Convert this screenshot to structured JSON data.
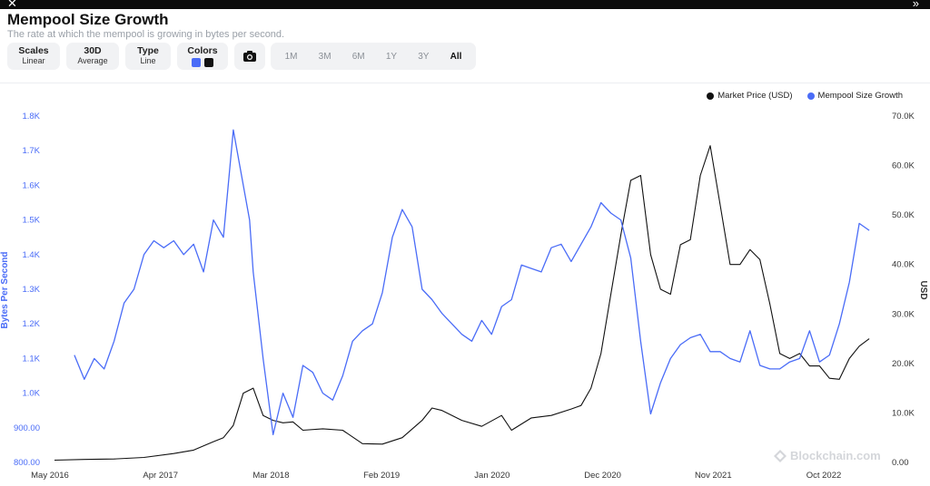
{
  "window": {
    "close_glyph": "✕",
    "collapse_glyph": "»"
  },
  "header": {
    "title": "Mempool Size Growth",
    "subtitle": "The rate at which the mempool is growing in bytes per second."
  },
  "controls": {
    "scales": {
      "label": "Scales",
      "value": "Linear"
    },
    "average": {
      "label": "30D",
      "value": "Average"
    },
    "type": {
      "label": "Type",
      "value": "Line"
    },
    "colors": {
      "label": "Colors",
      "swatch1": "#4a6cf7",
      "swatch2": "#111111"
    },
    "camera_icon": "camera-icon",
    "ranges": [
      "1M",
      "3M",
      "6M",
      "1Y",
      "3Y",
      "All"
    ],
    "active_range": "All"
  },
  "legend": {
    "items": [
      {
        "label": "Market Price (USD)",
        "color": "#111111"
      },
      {
        "label": "Mempool Size Growth",
        "color": "#4a6cf7"
      }
    ]
  },
  "watermark": {
    "text": "Blockchain.com"
  },
  "chart_data": {
    "type": "line",
    "title": "Mempool Size Growth",
    "xlabel": "",
    "ylabel_left": "Bytes Per Second",
    "ylabel_right": "USD",
    "x_tick_labels": [
      "May 2016",
      "Apr 2017",
      "Mar 2018",
      "Feb 2019",
      "Jan 2020",
      "Dec 2020",
      "Nov 2021",
      "Oct 2022"
    ],
    "y_left_ticks": [
      "800.00",
      "900.00",
      "1.0K",
      "1.1K",
      "1.2K",
      "1.3K",
      "1.4K",
      "1.5K",
      "1.6K",
      "1.7K",
      "1.8K"
    ],
    "y_right_ticks": [
      "0.00",
      "10.0K",
      "20.0K",
      "30.0K",
      "40.0K",
      "50.0K",
      "60.0K",
      "70.0K"
    ],
    "ylim_left": [
      800,
      1800
    ],
    "ylim_right": [
      0,
      70000
    ],
    "x_range": [
      "2016-05",
      "2023-04"
    ],
    "legend_position": "top-right",
    "series": [
      {
        "name": "Mempool Size Growth",
        "axis": "left",
        "color": "#4a6cf7",
        "x": [
          "2016-07",
          "2016-08",
          "2016-09",
          "2016-10",
          "2016-11",
          "2016-12",
          "2017-01",
          "2017-02",
          "2017-03",
          "2017-04",
          "2017-05",
          "2017-06",
          "2017-07",
          "2017-08",
          "2017-09",
          "2017-10",
          "2017-11",
          "2017-12",
          "2017-12-20",
          "2018-01",
          "2018-02",
          "2018-03",
          "2018-04",
          "2018-05",
          "2018-06",
          "2018-07",
          "2018-08",
          "2018-09",
          "2018-10",
          "2018-11",
          "2018-12",
          "2019-01",
          "2019-02",
          "2019-03",
          "2019-04",
          "2019-05",
          "2019-06",
          "2019-07",
          "2019-08",
          "2019-09",
          "2019-10",
          "2019-11",
          "2019-12",
          "2020-01",
          "2020-02",
          "2020-03",
          "2020-04",
          "2020-05",
          "2020-06",
          "2020-07",
          "2020-08",
          "2020-09",
          "2020-10",
          "2020-11",
          "2020-12",
          "2021-01",
          "2021-02",
          "2021-03",
          "2021-04",
          "2021-05",
          "2021-06",
          "2021-07",
          "2021-08",
          "2021-09",
          "2021-10",
          "2021-11",
          "2021-12",
          "2022-01",
          "2022-02",
          "2022-03",
          "2022-04",
          "2022-05",
          "2022-06",
          "2022-07",
          "2022-08",
          "2022-09",
          "2022-10",
          "2022-11",
          "2022-12",
          "2023-01",
          "2023-02",
          "2023-03"
        ],
        "values": [
          1110,
          1040,
          1100,
          1070,
          1150,
          1260,
          1300,
          1400,
          1440,
          1420,
          1440,
          1400,
          1430,
          1350,
          1500,
          1450,
          1760,
          1600,
          1500,
          1350,
          1100,
          880,
          1000,
          930,
          1080,
          1060,
          1000,
          980,
          1050,
          1150,
          1180,
          1200,
          1290,
          1450,
          1530,
          1480,
          1300,
          1270,
          1230,
          1200,
          1170,
          1150,
          1210,
          1170,
          1250,
          1270,
          1370,
          1360,
          1350,
          1420,
          1430,
          1380,
          1430,
          1480,
          1550,
          1520,
          1500,
          1390,
          1150,
          940,
          1030,
          1100,
          1140,
          1160,
          1170,
          1120,
          1120,
          1100,
          1090,
          1180,
          1080,
          1070,
          1070,
          1090,
          1100,
          1180,
          1090,
          1110,
          1200,
          1320,
          1490,
          1470
        ]
      },
      {
        "name": "Market Price (USD)",
        "axis": "right",
        "color": "#111111",
        "x": [
          "2016-05",
          "2016-08",
          "2016-11",
          "2017-02",
          "2017-05",
          "2017-07",
          "2017-09",
          "2017-10",
          "2017-11",
          "2017-12",
          "2018-01",
          "2018-02",
          "2018-03",
          "2018-04",
          "2018-05",
          "2018-06",
          "2018-08",
          "2018-10",
          "2018-12",
          "2019-02",
          "2019-04",
          "2019-06",
          "2019-07",
          "2019-08",
          "2019-10",
          "2019-12",
          "2020-02",
          "2020-03",
          "2020-05",
          "2020-07",
          "2020-09",
          "2020-10",
          "2020-11",
          "2020-12",
          "2021-01",
          "2021-02",
          "2021-03",
          "2021-04",
          "2021-05",
          "2021-06",
          "2021-07",
          "2021-08",
          "2021-09",
          "2021-10",
          "2021-11",
          "2021-12",
          "2022-01",
          "2022-02",
          "2022-03",
          "2022-04",
          "2022-05",
          "2022-06",
          "2022-07",
          "2022-08",
          "2022-09",
          "2022-10",
          "2022-11",
          "2022-12",
          "2023-01",
          "2023-02",
          "2023-03"
        ],
        "values": [
          450,
          600,
          700,
          1000,
          1800,
          2500,
          4200,
          5000,
          7500,
          14000,
          15000,
          9500,
          8500,
          8000,
          8200,
          6500,
          6800,
          6500,
          3800,
          3700,
          5000,
          8500,
          11000,
          10500,
          8500,
          7300,
          9500,
          6500,
          9000,
          9500,
          10800,
          11500,
          15000,
          22000,
          34000,
          46000,
          57000,
          58000,
          42000,
          35000,
          34000,
          44000,
          45000,
          58000,
          64000,
          52000,
          40000,
          40000,
          43000,
          41000,
          32000,
          22000,
          21000,
          22000,
          19500,
          19500,
          17000,
          16800,
          21000,
          23500,
          25000
        ]
      }
    ]
  }
}
